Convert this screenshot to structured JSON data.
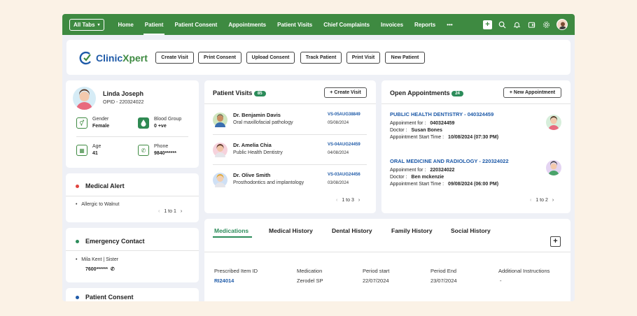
{
  "nav": {
    "all_tabs": "All Tabs",
    "items": [
      "Home",
      "Patient",
      "Patient Consent",
      "Appointments",
      "Patient Visits",
      "Chief Complaints",
      "Invoices",
      "Reports"
    ],
    "active": "Patient",
    "more": "•••"
  },
  "brand": {
    "name_a": "Clinic",
    "name_b": "Xpert"
  },
  "actions": [
    "Create Visit",
    "Print Consent",
    "Upload Consent",
    "Track Patient",
    "Print Visit",
    "New Patient"
  ],
  "patient": {
    "name": "Linda Joseph",
    "opid": "OPID - 220324022",
    "gender_label": "Gender",
    "gender": "Female",
    "blood_label": "Blood Group",
    "blood": "0 +ve",
    "age_label": "Age",
    "age": "41",
    "phone_label": "Phone",
    "phone": "9840******"
  },
  "medical_alert": {
    "title": "Medical Alert",
    "item": "Allergic to Walnut",
    "pager": "1 to 1"
  },
  "emergency": {
    "title": "Emergency Contact",
    "name": "Mila Kent",
    "relation": "Sister",
    "phone": "7600******"
  },
  "consent": {
    "title": "Patient Consent"
  },
  "visits": {
    "title": "Patient Visits",
    "count": "85",
    "create": "+ Create Visit",
    "items": [
      {
        "doctor": "Dr. Benjamin Davis",
        "spec": "Oral maxillofacial pathology",
        "id": "VS-05AUG38849",
        "date": "05/08/2024"
      },
      {
        "doctor": "Dr. Amelia Chia",
        "spec": "Public Health Dentistry",
        "id": "VS-04AUG24459",
        "date": "04/08/2024"
      },
      {
        "doctor": "Dr. Olive Smith",
        "spec": "Prosthodontics and implantology",
        "id": "VS-03AUG24456",
        "date": "03/08/2024"
      }
    ],
    "pager": "1 to 3"
  },
  "appointments": {
    "title": "Open Appointments",
    "count": "24",
    "new": "+ New Appointment",
    "items": [
      {
        "title": "PUBLIC HEALTH DENTISTRY - 040324459",
        "for_label": "Appoinment for :",
        "for": "040324459",
        "doc_label": "Doctor :",
        "doctor": "Susan Bones",
        "start_label": "Appointment Start Time :",
        "start": "10/08/2024 (07:30 PM)"
      },
      {
        "title": "ORAL MEDICINE AND RADIOLOGY - 220324022",
        "for_label": "Appoinment for :",
        "for": "220324022",
        "doc_label": "Doctor :",
        "doctor": "Ben mckenzie",
        "start_label": "Appointment Start Time :",
        "start": "09/08/2024 (06:00 PM)"
      }
    ],
    "pager": "1 to 2"
  },
  "tabs": {
    "items": [
      "Medications",
      "Medical History",
      "Dental History",
      "Family History",
      "Social History"
    ],
    "active": "Medications",
    "columns": [
      "Prescribed Item ID",
      "Medication",
      "Period start",
      "Period End",
      "Additional Instructions"
    ],
    "row": [
      "RI24014",
      "Zerodel SP",
      "22/07/2024",
      "23/07/2024",
      "-"
    ]
  },
  "colors": {
    "brand_green": "#3e8a41",
    "link_blue": "#1e5aa8",
    "badge_green": "#2c8c5a",
    "alert_red": "#e0443e"
  }
}
